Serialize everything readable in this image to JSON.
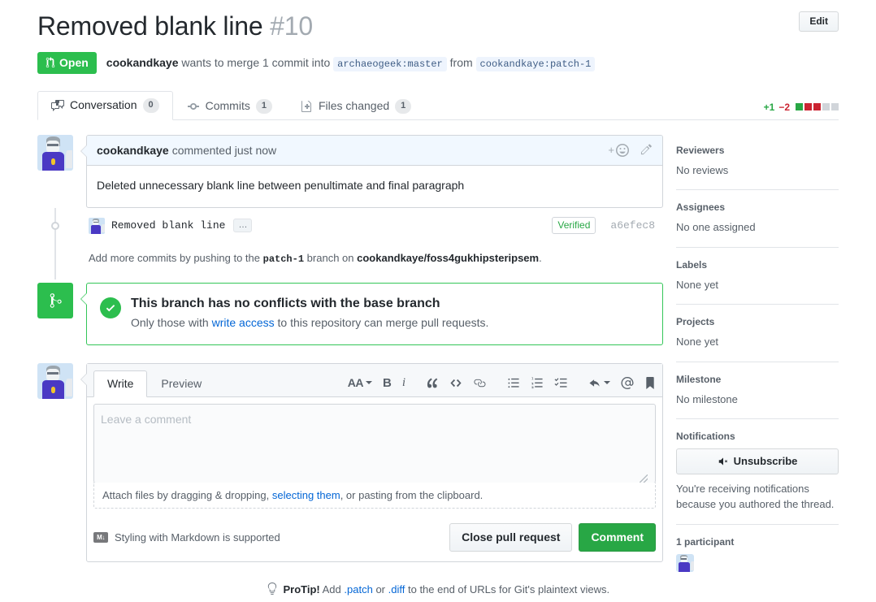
{
  "header": {
    "title": "Removed blank line",
    "number": "#10",
    "edit_label": "Edit",
    "state": "Open",
    "author": "cookandkaye",
    "meta_middle": "wants to merge 1 commit into",
    "base_branch": "archaeogeek:master",
    "from_word": "from",
    "head_branch": "cookandkaye:patch-1"
  },
  "tabs": [
    {
      "label": "Conversation",
      "count": "0",
      "icon": "comment-discussion-icon",
      "selected": true
    },
    {
      "label": "Commits",
      "count": "1",
      "icon": "git-commit-icon",
      "selected": false
    },
    {
      "label": "Files changed",
      "count": "1",
      "icon": "diff-file-icon",
      "selected": false
    }
  ],
  "diffstat": {
    "additions": "+1",
    "deletions": "−2",
    "blocks": [
      "a",
      "d",
      "d",
      "n",
      "n"
    ]
  },
  "comment": {
    "author": "cookandkaye",
    "action": "commented",
    "timestamp": "just now",
    "body": "Deleted unnecessary blank line between penultimate and final paragraph"
  },
  "commit": {
    "message": "Removed blank line",
    "ellipsis": "…",
    "verified": "Verified",
    "sha": "a6efec8"
  },
  "push_note": {
    "prefix": "Add more commits by pushing to the",
    "branch": "patch-1",
    "middle": "branch on",
    "repo": "cookandkaye/foss4gukhipsteripsem",
    "suffix": "."
  },
  "merge_status": {
    "title": "This branch has no conflicts with the base branch",
    "sub_prefix": "Only those with",
    "sub_link": "write access",
    "sub_suffix": "to this repository can merge pull requests."
  },
  "composer": {
    "tabs": [
      {
        "label": "Write",
        "selected": true
      },
      {
        "label": "Preview",
        "selected": false
      }
    ],
    "toolbar": [
      {
        "name": "text-size-icon",
        "glyph": "AA"
      },
      {
        "name": "bold-icon",
        "glyph": "B"
      },
      {
        "name": "italic-icon",
        "glyph": "i"
      },
      {
        "name": "quote-icon",
        "glyph": "“"
      },
      {
        "name": "code-icon",
        "glyph": "<>"
      },
      {
        "name": "link-icon",
        "glyph": "⧉"
      },
      {
        "name": "unordered-list-icon",
        "glyph": "≡"
      },
      {
        "name": "ordered-list-icon",
        "glyph": "≡"
      },
      {
        "name": "task-list-icon",
        "glyph": "✓"
      },
      {
        "name": "reply-icon",
        "glyph": "↩"
      },
      {
        "name": "mention-icon",
        "glyph": "@"
      },
      {
        "name": "saved-replies-icon",
        "glyph": "⚑"
      }
    ],
    "placeholder": "Leave a comment",
    "value": "",
    "attach_prefix": "Attach files by dragging & dropping,",
    "attach_link": "selecting them",
    "attach_suffix": ", or pasting from the clipboard.",
    "markdown_note": "Styling with Markdown is supported",
    "markdown_mark": "M↓",
    "close_label": "Close pull request",
    "comment_label": "Comment"
  },
  "sidebar": {
    "sections": [
      {
        "title": "Reviewers",
        "text": "No reviews"
      },
      {
        "title": "Assignees",
        "text": "No one assigned"
      },
      {
        "title": "Labels",
        "text": "None yet"
      },
      {
        "title": "Projects",
        "text": "None yet"
      },
      {
        "title": "Milestone",
        "text": "No milestone"
      }
    ],
    "notifications": {
      "title": "Notifications",
      "button_label": "Unsubscribe",
      "note": "You're receiving notifications because you authored the thread."
    },
    "participants": {
      "title": "1 participant"
    }
  },
  "protip": {
    "label": "ProTip!",
    "prefix": "Add",
    "link1": ".patch",
    "or": "or",
    "link2": ".diff",
    "suffix": "to the end of URLs for Git's plaintext views."
  },
  "colors": {
    "open_green": "#2cbe4e",
    "addition": "#28a745",
    "deletion": "#cb2431",
    "link": "#0366d6"
  }
}
